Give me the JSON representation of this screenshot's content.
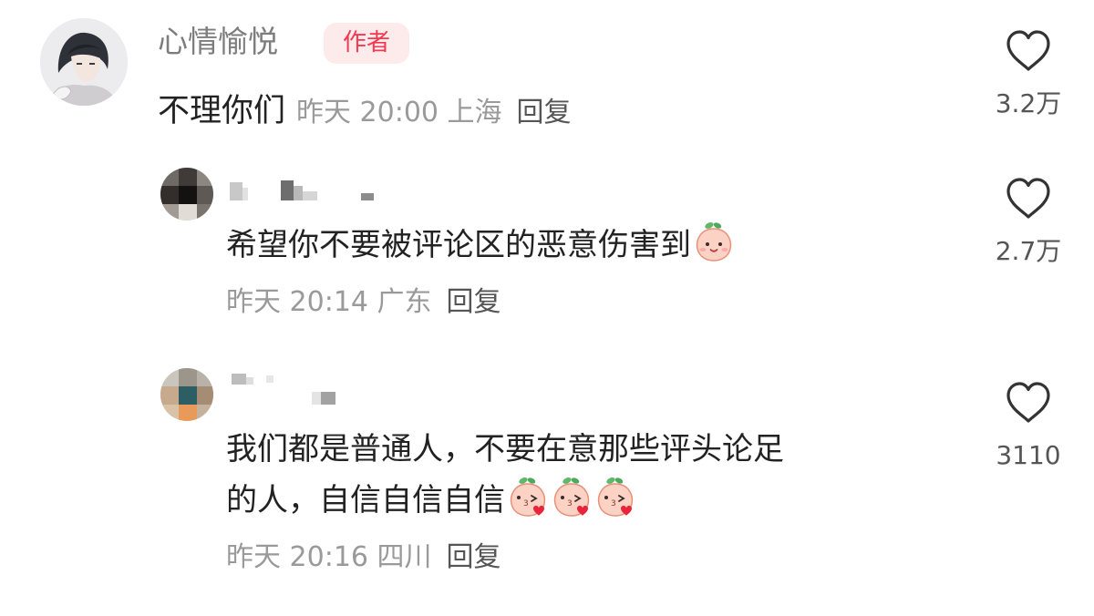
{
  "author_comment": {
    "username": "心情愉悦",
    "badge": "作者",
    "text": "不理你们",
    "meta": "昨天 20:00 上海",
    "reply_label": "回复",
    "likes": "3.2万"
  },
  "replies": [
    {
      "text": "希望你不要被评论区的恶意伤害到",
      "emojis": [
        "peach-face-emoji"
      ],
      "meta": "昨天 20:14 广东",
      "reply_label": "回复",
      "likes": "2.7万"
    },
    {
      "text_line1": "我们都是普通人，不要在意那些评头论足",
      "text_line2": "的人，自信自信自信",
      "emojis": [
        "peach-kiss-emoji",
        "peach-kiss-emoji",
        "peach-kiss-emoji"
      ],
      "meta": "昨天 20:16 四川",
      "reply_label": "回复",
      "likes": "3110"
    }
  ],
  "colors": {
    "username": "#7d7d7d",
    "badge_text": "#f5384f",
    "badge_bg": "#fdeaea",
    "meta": "#9a9a9a",
    "body_text": "#222222"
  }
}
